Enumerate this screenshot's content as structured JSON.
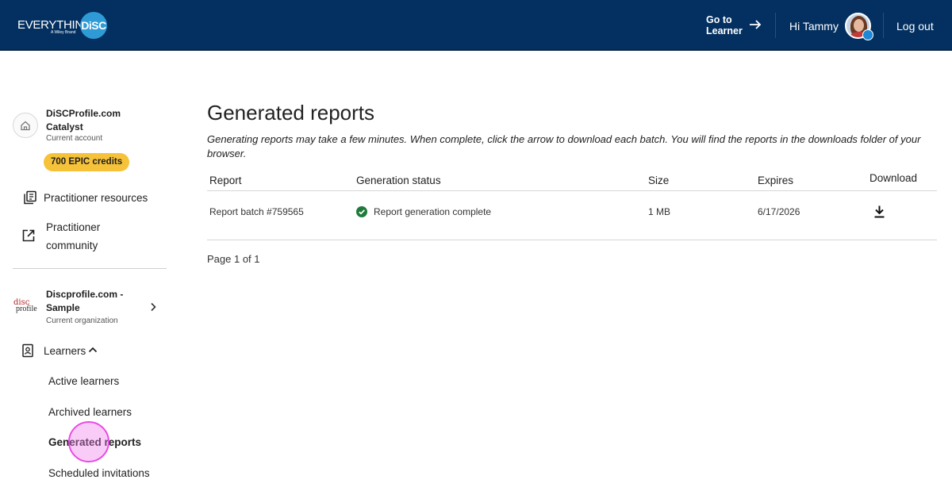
{
  "header": {
    "logo_word": "EVERYTHING",
    "logo_disc": "DiSC",
    "logo_tagline": "A Wiley Brand",
    "goto_line1": "Go to",
    "goto_line2": "Learner",
    "greeting": "Hi Tammy",
    "logout": "Log out",
    "bg_color": "#033060"
  },
  "sidebar": {
    "account_name": "DiSCProfile.com Catalyst",
    "account_sub": "Current account",
    "credits": "700 EPIC credits",
    "resources": "Practitioner resources",
    "community_line1": "Practitioner",
    "community_line2": "community",
    "org_logo_top": "disc",
    "org_logo_bottom": "profile",
    "org_name": "Discprofile.com - Sample",
    "org_sub": "Current organization",
    "learners": "Learners",
    "items": [
      {
        "label": "Active learners",
        "active": false
      },
      {
        "label": "Archived learners",
        "active": false
      },
      {
        "label": "Generated reports",
        "active": true
      },
      {
        "label": "Scheduled invitations",
        "active": false
      }
    ]
  },
  "main": {
    "title": "Generated reports",
    "description": "Generating reports may take a few minutes. When complete, click the arrow to download each batch. You will find the reports in the downloads folder of your browser.",
    "columns": {
      "report": "Report",
      "status": "Generation status",
      "size": "Size",
      "expires": "Expires",
      "download": "Download"
    },
    "rows": [
      {
        "report": "Report batch #759565",
        "status": "Report generation complete",
        "size": "1 MB",
        "expires": "6/17/2026"
      }
    ],
    "pager": "Page 1 of 1"
  },
  "colors": {
    "accent_yellow": "#f6c23a",
    "success_green": "#1f7a3a"
  }
}
